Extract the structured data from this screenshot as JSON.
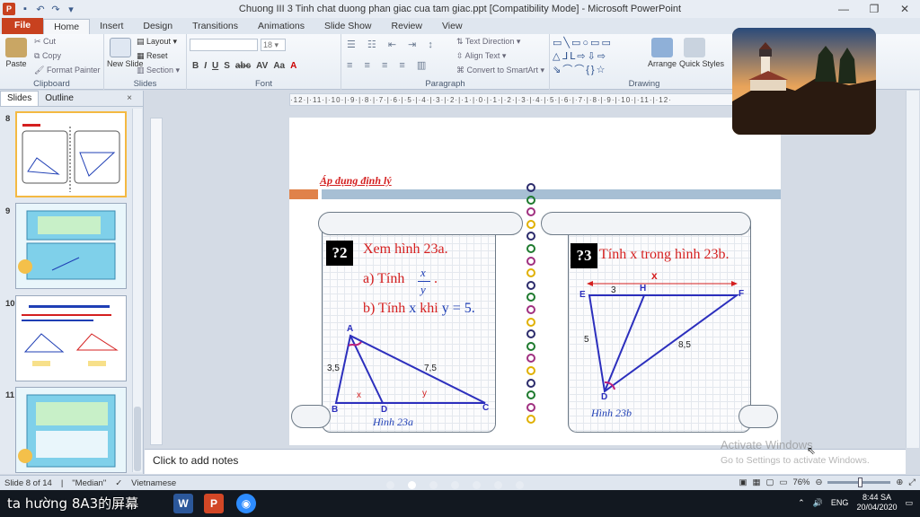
{
  "window": {
    "title": "Chuong III 3 Tinh chat duong phan giac cua tam giac.ppt [Compatibility Mode]  -  Microsoft PowerPoint"
  },
  "ribbon_tabs": [
    "File",
    "Home",
    "Insert",
    "Design",
    "Transitions",
    "Animations",
    "Slide Show",
    "Review",
    "View"
  ],
  "active_tab": "Home",
  "ribbon": {
    "clipboard": {
      "paste": "Paste",
      "cut": "Cut",
      "copy": "Copy",
      "format_painter": "Format Painter",
      "label": "Clipboard"
    },
    "slides": {
      "new_slide": "New Slide",
      "layout": "Layout",
      "reset": "Reset",
      "section": "Section",
      "label": "Slides"
    },
    "font": {
      "size": "18",
      "label": "Font"
    },
    "paragraph": {
      "text_direction": "Text Direction",
      "align_text": "Align Text",
      "smartart": "Convert to SmartArt",
      "label": "Paragraph"
    },
    "drawing": {
      "arrange": "Arrange",
      "quick_styles": "Quick Styles",
      "label": "Drawing"
    }
  },
  "panel": {
    "tab_slides": "Slides",
    "tab_outline": "Outline",
    "close": "×",
    "slide_numbers": [
      "8",
      "9",
      "10",
      "11"
    ]
  },
  "ruler": {
    "text": "·12·|·11·|·10·|·9·|·8·|·7·|·6·|·5·|·4·|·3·|·2·|·1·|·0·|·1·|·2·|·3·|·4·|·5·|·6·|·7·|·8·|·9·|·10·|·11·|·12·"
  },
  "slide": {
    "heading": "Áp dụng định lý",
    "left": {
      "badge": "?2",
      "line1": "Xem hình 23a.",
      "line2_prefix": "a) Tính",
      "frac_num": "x",
      "frac_den": "y",
      "line2_suffix": ".",
      "line3_prefix": "b) Tính",
      "line3_x": "x",
      "line3_mid": "khi",
      "line3_y": "y",
      "line3_suffix": "= 5.",
      "labels": {
        "A": "A",
        "B": "B",
        "D": "D",
        "C": "C",
        "ab": "3,5",
        "ac": "7,5",
        "x": "x",
        "y": "y"
      },
      "caption": "Hình 23a"
    },
    "right": {
      "badge": "?3",
      "line1": "Tính x trong hình 23b.",
      "labels": {
        "E": "E",
        "H": "H",
        "F": "F",
        "D": "D",
        "eh": "3",
        "ed": "5",
        "df": "8,5",
        "x": "x"
      },
      "caption": "Hình 23b"
    }
  },
  "notes": {
    "placeholder": "Click to add notes"
  },
  "watermark": {
    "line1": "Activate Windows",
    "line2": "Go to Settings to activate Windows."
  },
  "status": {
    "slide": "Slide 8 of 14",
    "theme": "\"Median\"",
    "language": "Vietnamese",
    "zoom": "76%"
  },
  "taskbar": {
    "subtitle": "ta hường 8A3的屏幕",
    "language": "ENG",
    "time": "8:44 SA",
    "date": "20/04/2020"
  }
}
